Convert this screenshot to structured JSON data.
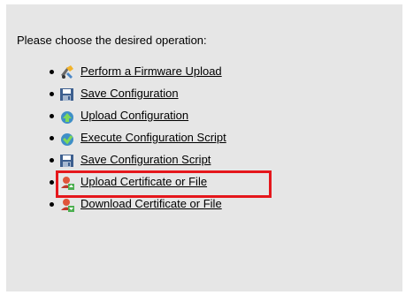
{
  "prompt": "Please choose the desired operation:",
  "operations": [
    {
      "label": "Perform a Firmware Upload",
      "icon": "firmware-upload-icon"
    },
    {
      "label": "Save Configuration",
      "icon": "save-icon"
    },
    {
      "label": "Upload Configuration",
      "icon": "upload-icon"
    },
    {
      "label": "Execute Configuration Script",
      "icon": "execute-script-icon"
    },
    {
      "label": "Save Configuration Script",
      "icon": "save-icon"
    },
    {
      "label": "Upload Certificate or File",
      "icon": "certificate-upload-icon",
      "highlighted": true
    },
    {
      "label": "Download Certificate or File",
      "icon": "certificate-download-icon"
    }
  ],
  "colors": {
    "panel_background": "#e6e6e6",
    "highlight_border": "#e5171c"
  }
}
